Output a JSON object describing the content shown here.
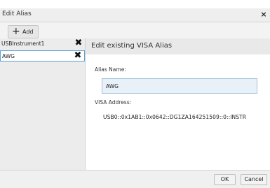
{
  "dialog": {
    "title": "Edit Alias",
    "close_label": "×",
    "close_icon": "close-icon"
  },
  "toolbar": {
    "add_icon": "plus-icon",
    "add_symbol": "+",
    "add_label": "Add"
  },
  "aliases": [
    {
      "name": "USBInstrument1",
      "delete_symbol": "✖",
      "delete_icon": "delete-icon",
      "selected": false
    },
    {
      "name": "AWG",
      "delete_symbol": "✖",
      "delete_icon": "delete-icon",
      "selected": true
    }
  ],
  "editor": {
    "heading": "Edit existing VISA Alias",
    "alias_name_label": "Alias Name:",
    "alias_name_value": "AWG",
    "visa_address_label": "VISA Address:",
    "visa_address_value": "USB0::0x1AB1::0x0642::DG1ZA164251509::0::INSTR"
  },
  "footer": {
    "ok_label": "OK",
    "cancel_label": "Cancel"
  },
  "colors": {
    "selection_border": "#5aa3d6",
    "input_background": "#e8f1f8"
  }
}
